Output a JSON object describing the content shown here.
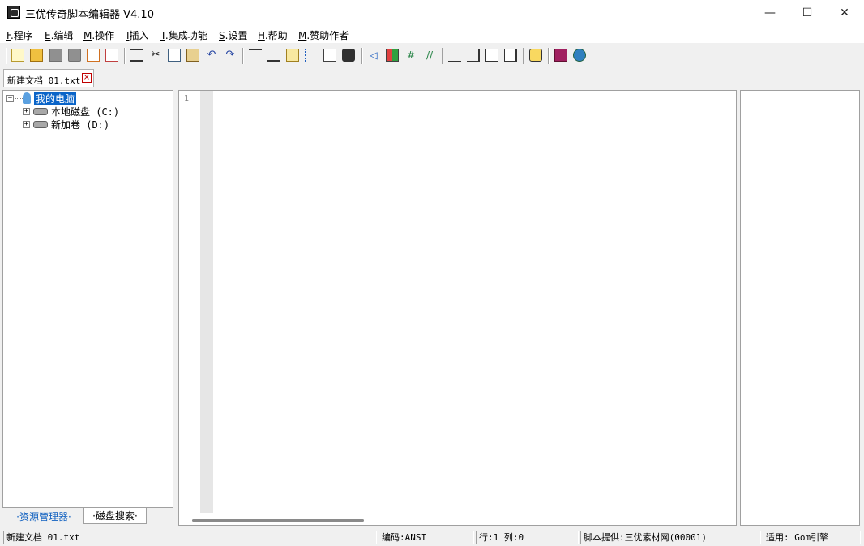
{
  "window": {
    "title": "三优传奇脚本编辑器 V4.10"
  },
  "window_controls": {
    "minimize": "—",
    "maximize": "☐",
    "close": "✕"
  },
  "menu": [
    {
      "key": "F",
      "label": ".程序"
    },
    {
      "key": "E",
      "label": ".编辑"
    },
    {
      "key": "M",
      "label": ".操作"
    },
    {
      "key": "I",
      "label": "插入"
    },
    {
      "key": "T",
      "label": ".集成功能"
    },
    {
      "key": "S",
      "label": ".设置"
    },
    {
      "key": "H",
      "label": ".帮助"
    },
    {
      "key": "M",
      "label": ".赞助作者"
    }
  ],
  "doc_tab": {
    "label": "新建文档 01.txt",
    "close": "×"
  },
  "tree": {
    "root": "我的电脑",
    "drives": [
      "本地磁盘 (C:)",
      "新加卷 (D:)"
    ],
    "expand_root": "−",
    "expand_child": "+"
  },
  "left_tabs": [
    "·资源管理器·",
    "·磁盘搜索·"
  ],
  "editor": {
    "line_number": "1"
  },
  "status": {
    "file": "新建文档 01.txt",
    "encoding": "编码:ANSI",
    "position": "行:1  列:0",
    "provider": "脚本提供:三优素材网(00001)",
    "engine": "适用: Gom引擎"
  }
}
